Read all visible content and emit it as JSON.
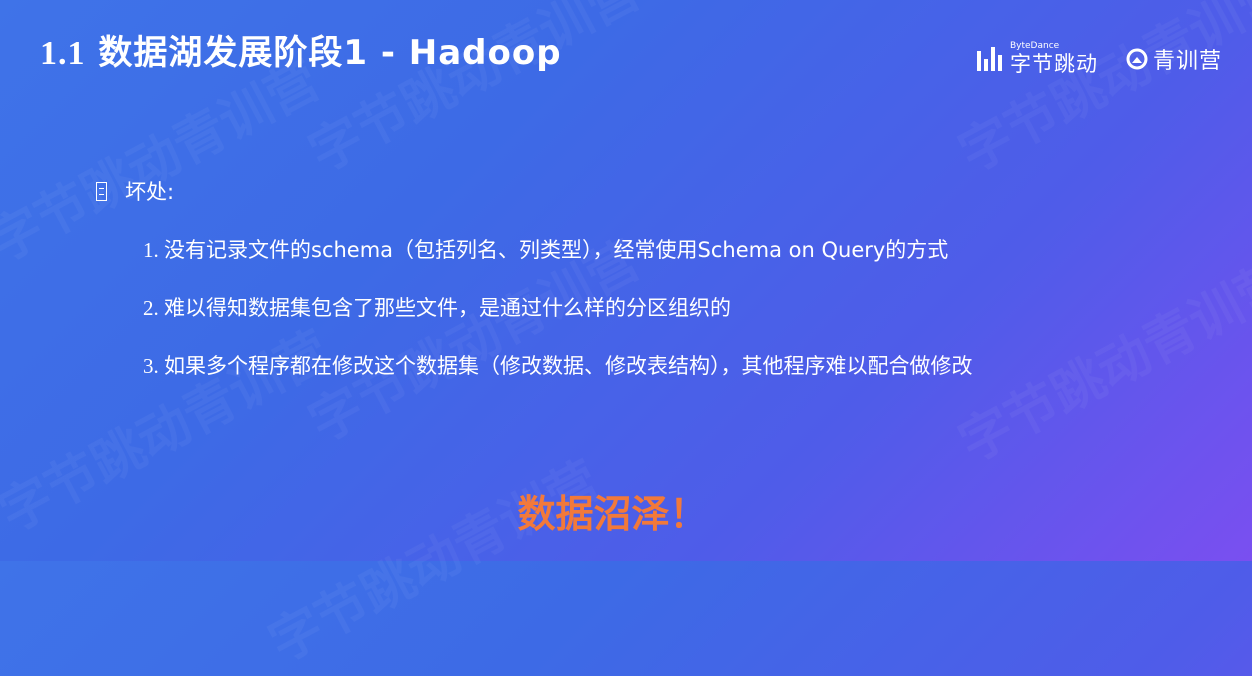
{
  "slide": {
    "title_num": "1.1",
    "title_text": " 数据湖发展阶段1 - Hadoop"
  },
  "brand": {
    "bytedance_en": "ByteDance",
    "bytedance_cn": "字节跳动",
    "camp": "青训营",
    "bytedance_icon": "bytedance-bars-icon",
    "camp_icon": "youth-camp-logo-icon"
  },
  "section": {
    "icon": "document-icon",
    "heading": "坏处:"
  },
  "items": [
    {
      "num": "1.",
      "text": "没有记录文件的schema（包括列名、列类型），经常使用Schema on Query的方式"
    },
    {
      "num": "2.",
      "text": "难以得知数据集包含了那些文件，是通过什么样的分区组织的"
    },
    {
      "num": "3.",
      "text": "如果多个程序都在修改这个数据集（修改数据、修改表结构），其他程序难以配合做修改"
    }
  ],
  "callout": "数据沼泽！",
  "watermark": "字节跳动青训营",
  "colors": {
    "callout": "#f2793a",
    "bg_start": "#3f73e8",
    "bg_end": "#7a4ff0"
  }
}
